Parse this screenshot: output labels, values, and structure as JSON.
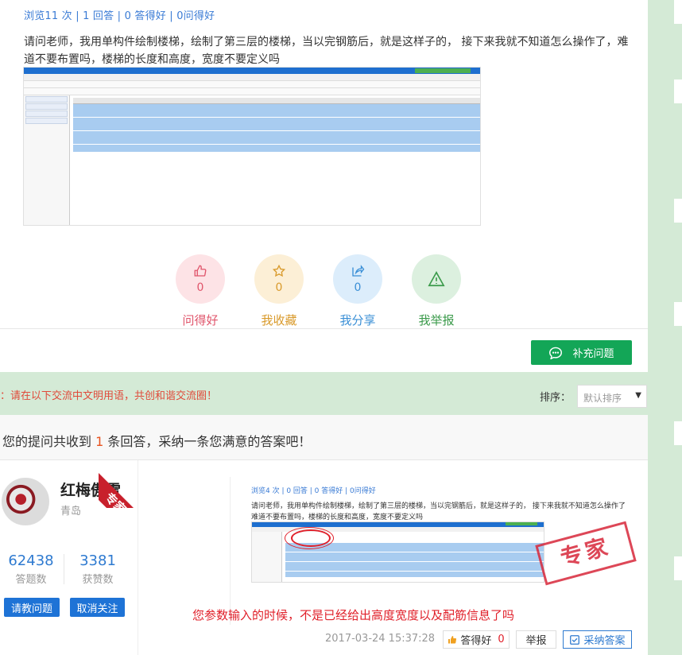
{
  "question": {
    "meta": "浏览11 次 | 1 回答 | 0 答得好 | 0问得好",
    "text": "请问老师，我用单构件绘制楼梯，绘制了第三层的楼梯，当以完钢筋后，就是这样子的， 接下来我就不知道怎么操作了，难道不要布置吗，楼梯的长度和高度，宽度不要定义吗"
  },
  "actions": [
    {
      "icon": "thumbs-up-icon",
      "count": "0",
      "label": "问得好",
      "color": "#e0556b"
    },
    {
      "icon": "star-icon",
      "count": "0",
      "label": "我收藏",
      "color": "#d99a2b"
    },
    {
      "icon": "share-icon",
      "count": "0",
      "label": "我分享",
      "color": "#3a8fd6"
    },
    {
      "icon": "warning-icon",
      "count": "0",
      "label": "我举报",
      "color": "#3a9a4a"
    }
  ],
  "supplement_button": "补充问题",
  "notice": "：请在以下交流中文明用语，共创和谐交流圈！",
  "sort": {
    "label": "排序：",
    "value": "默认排序"
  },
  "answers_header": {
    "prefix": "您的提问共收到 ",
    "count": "1",
    "suffix": " 条回答，采纳一条您满意的答案吧！"
  },
  "answerer": {
    "badge": "专家",
    "name": "红梅傲雪",
    "city": "青岛",
    "answers_count": "62438",
    "answers_label": "答题数",
    "likes_count": "3381",
    "likes_label": "获赞数",
    "ask_button": "请教问题",
    "unfollow_button": "取消关注"
  },
  "answer": {
    "image_meta": "浏览4 次 | 0 回答 | 0 答得好 | 0问得好",
    "image_text": "请问老师，我用单构件绘制楼梯，绘制了第三层的楼梯，当以完钢筋后，就是这样子的， 接下来我就不知道怎么操作了难道不要布置吗，楼梯的长度和高度，宽度不要定义吗",
    "stamp": "专家",
    "text": "您参数输入的时候，不是已经给出高度宽度以及配筋信息了吗",
    "time": "2017-03-24 15:37:28",
    "good_label": "答得好",
    "good_count": "0",
    "report_label": "举报",
    "adopt_label": "采纳答案"
  },
  "colors": {
    "green": "#13a657",
    "blue": "#1e73d6",
    "red": "#e0202a",
    "page_bg": "#d4ead6"
  }
}
